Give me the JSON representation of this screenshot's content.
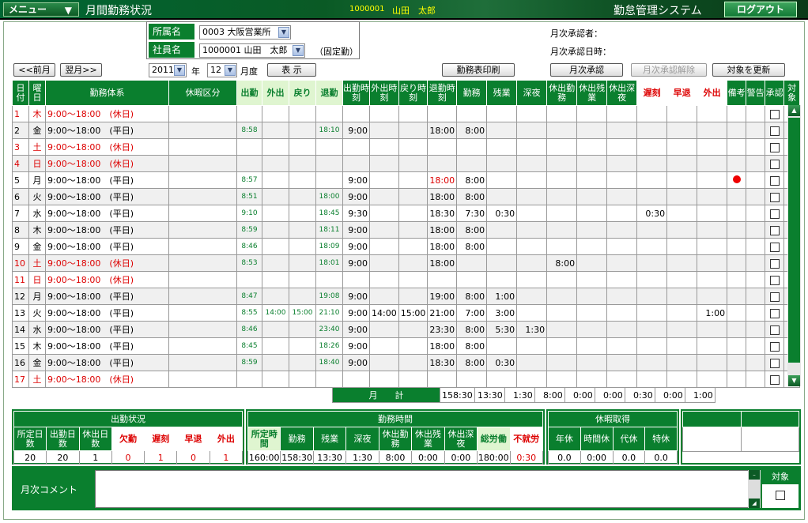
{
  "header": {
    "menu_label": "メニュー",
    "menu_arrow": "▼",
    "screen_title": "月間勤務状況",
    "user_id": "1000001",
    "user_name": "山田　太郎",
    "system_name": "勤怠管理システム",
    "logout_label": "ログアウト"
  },
  "filters": {
    "office_label": "所属名",
    "office_value": "0003 大阪営業所",
    "employee_label": "社員名",
    "employee_value": "1000001 山田　太郎",
    "fixed_note": "（固定勤）",
    "year_value": "2011",
    "year_suffix": "年",
    "month_value": "12",
    "month_suffix": "月度",
    "display_label": "表 示",
    "dropdown_icon": "▼"
  },
  "approval": {
    "approver_label": "月次承認者：",
    "approved_at_label": "月次承認日時："
  },
  "buttons": {
    "prev": "<<前月",
    "next": "翌月>>",
    "print": "勤務表印刷",
    "approve": "月次承認",
    "unapprove": "月次承認解除",
    "refresh": "対象を更新"
  },
  "grid": {
    "headers": [
      "日付",
      "曜日",
      "勤務体系",
      "休暇区分",
      "出勤",
      "外出",
      "戻り",
      "退勤",
      "出勤時刻",
      "外出時刻",
      "戻り時刻",
      "退勤時刻",
      "勤務",
      "残業",
      "深夜",
      "休出勤務",
      "休出残業",
      "休出深夜",
      "遅刻",
      "早退",
      "外出",
      "備考",
      "警告",
      "承認",
      "対象"
    ],
    "rows": [
      {
        "d": "1",
        "w": "木",
        "p": "9:00～18:00　(休日)",
        "hol": true
      },
      {
        "d": "2",
        "w": "金",
        "p": "9:00～18:00　(平日)",
        "cin": "8:58",
        "cout": "18:10",
        "t_in": "9:00",
        "t_out": "18:00",
        "work": "8:00"
      },
      {
        "d": "3",
        "w": "土",
        "p": "9:00～18:00　(休日)",
        "hol": true
      },
      {
        "d": "4",
        "w": "日",
        "p": "9:00～18:00　(休日)",
        "hol": true
      },
      {
        "d": "5",
        "w": "月",
        "p": "9:00～18:00　(平日)",
        "cin": "8:57",
        "t_in": "9:00",
        "t_out": "18:00",
        "t_out_red": true,
        "work": "8:00",
        "note_dot": true
      },
      {
        "d": "6",
        "w": "火",
        "p": "9:00～18:00　(平日)",
        "cin": "8:51",
        "cout": "18:00",
        "t_in": "9:00",
        "t_out": "18:00",
        "work": "8:00"
      },
      {
        "d": "7",
        "w": "水",
        "p": "9:00～18:00　(平日)",
        "cin": "9:10",
        "cout": "18:45",
        "t_in": "9:30",
        "t_out": "18:30",
        "work": "7:30",
        "ot": "0:30",
        "late": "0:30"
      },
      {
        "d": "8",
        "w": "木",
        "p": "9:00～18:00　(平日)",
        "cin": "8:59",
        "cout": "18:11",
        "t_in": "9:00",
        "t_out": "18:00",
        "work": "8:00"
      },
      {
        "d": "9",
        "w": "金",
        "p": "9:00～18:00　(平日)",
        "cin": "8:46",
        "cout": "18:09",
        "t_in": "9:00",
        "t_out": "18:00",
        "work": "8:00"
      },
      {
        "d": "10",
        "w": "土",
        "p": "9:00～18:00　(休日)",
        "hol": true,
        "cin": "8:53",
        "cout": "18:01",
        "t_in": "9:00",
        "t_out": "18:00",
        "hw": "8:00"
      },
      {
        "d": "11",
        "w": "日",
        "p": "9:00～18:00　(休日)",
        "hol": true
      },
      {
        "d": "12",
        "w": "月",
        "p": "9:00～18:00　(平日)",
        "cin": "8:47",
        "cout": "19:08",
        "t_in": "9:00",
        "t_out": "19:00",
        "work": "8:00",
        "ot": "1:00"
      },
      {
        "d": "13",
        "w": "火",
        "p": "9:00～18:00　(平日)",
        "cin": "8:55",
        "gout": "14:00",
        "gback": "15:00",
        "cout": "21:10",
        "t_in": "9:00",
        "t_go": "14:00",
        "t_gb": "15:00",
        "t_out": "21:00",
        "work": "7:00",
        "ot": "3:00",
        "outt": "1:00"
      },
      {
        "d": "14",
        "w": "水",
        "p": "9:00～18:00　(平日)",
        "cin": "8:46",
        "cout": "23:40",
        "t_in": "9:00",
        "t_out": "23:30",
        "work": "8:00",
        "ot": "5:30",
        "night": "1:30"
      },
      {
        "d": "15",
        "w": "木",
        "p": "9:00～18:00　(平日)",
        "cin": "8:45",
        "cout": "18:26",
        "t_in": "9:00",
        "t_out": "18:00",
        "work": "8:00"
      },
      {
        "d": "16",
        "w": "金",
        "p": "9:00～18:00　(平日)",
        "cin": "8:59",
        "cout": "18:40",
        "t_in": "9:00",
        "t_out": "18:30",
        "work": "8:00",
        "ot": "0:30"
      },
      {
        "d": "17",
        "w": "土",
        "p": "9:00～18:00　(休日)",
        "hol": true
      }
    ],
    "totals_label": "月　　計",
    "totals": [
      "158:30",
      "13:30",
      "1:30",
      "8:00",
      "0:00",
      "0:00",
      "0:30",
      "0:00",
      "1:00"
    ]
  },
  "attendance": {
    "title": "出勤状況",
    "headers": [
      "所定日数",
      "出勤日数",
      "休出日数",
      "欠勤",
      "遅刻",
      "早退",
      "外出"
    ],
    "values": [
      "20",
      "20",
      "1",
      "0",
      "1",
      "0",
      "1"
    ]
  },
  "worktime": {
    "title": "勤務時間",
    "headers": [
      "所定時間",
      "勤務",
      "残業",
      "深夜",
      "休出勤務",
      "休出残業",
      "休出深夜",
      "総労働",
      "不就労"
    ],
    "values": [
      "160:00",
      "158:30",
      "13:30",
      "1:30",
      "8:00",
      "0:00",
      "0:00",
      "180:00",
      "0:30"
    ]
  },
  "leave": {
    "title": "休暇取得",
    "headers": [
      "年休",
      "時間休",
      "代休",
      "特休"
    ],
    "values": [
      "0.0",
      "0:00",
      "0.0",
      "0.0"
    ]
  },
  "comment": {
    "label": "月次コメント",
    "target_label": "対象"
  }
}
